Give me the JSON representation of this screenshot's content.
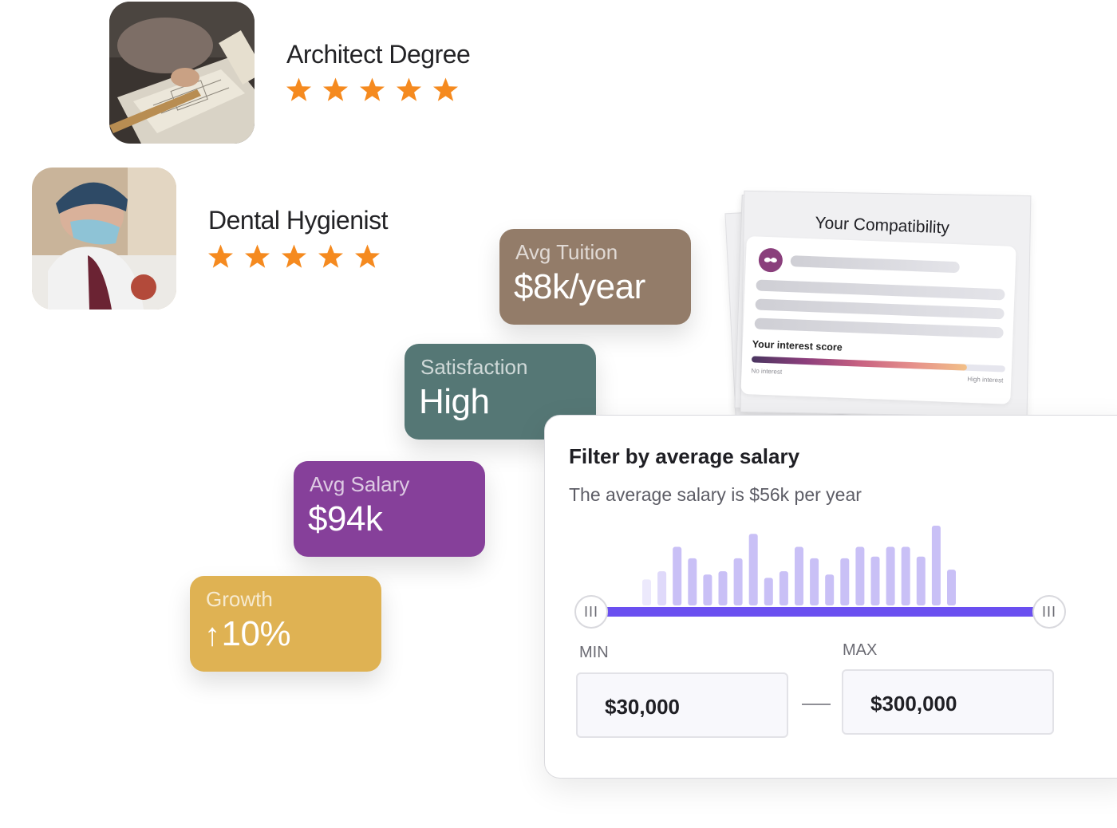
{
  "careers": [
    {
      "title": "Architect Degree",
      "photo_icon": "architect-photo",
      "rating": 5,
      "rating_max": 5
    },
    {
      "title": "Dental Hygienist",
      "photo_icon": "dental-photo",
      "rating": 5,
      "rating_max": 5
    }
  ],
  "stats": {
    "tuition": {
      "label": "Avg Tuition",
      "value": "$8k/year",
      "color": "#937c69"
    },
    "satisfaction": {
      "label": "Satisfaction",
      "value": "High",
      "color": "#557775"
    },
    "salary": {
      "label": "Avg Salary",
      "value": "$94k",
      "color": "#86409a"
    },
    "growth": {
      "label": "Growth",
      "arrow": "↑",
      "value": "10%",
      "color": "#dfb253"
    }
  },
  "compatibility": {
    "title": "Your Compatibility",
    "avatar_icon": "mustache-icon",
    "interest_label": "Your interest score",
    "min_label": "No interest",
    "max_label": "High interest",
    "interest_level": 0.85
  },
  "salary_filter": {
    "title": "Filter by average salary",
    "subtitle": "The average salary is $56k per year",
    "min_label": "MIN",
    "max_label": "MAX",
    "min_value": "$30,000",
    "max_value": "$300,000",
    "handle_glyph": "III",
    "histogram_levels": [
      0.32,
      0.42,
      0.72,
      0.58,
      0.38,
      0.42,
      0.58,
      0.88,
      0.34,
      0.42,
      0.72,
      0.58,
      0.38,
      0.58,
      0.72,
      0.6,
      0.72,
      0.72,
      0.6,
      0.98,
      0.44
    ],
    "accent": "#6a4ff0",
    "bar_color": "#c9c0f6"
  },
  "star_color": "#f58a1f"
}
